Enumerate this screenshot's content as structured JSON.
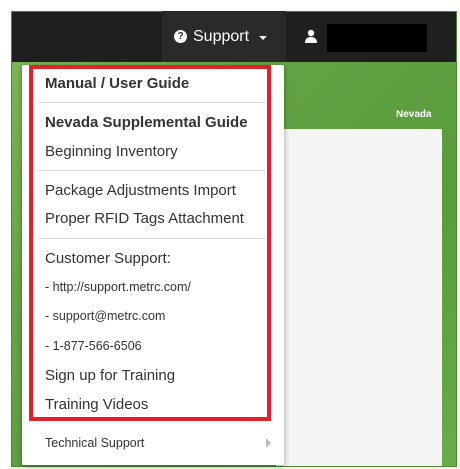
{
  "topbar": {
    "support_label": "Support",
    "help_icon": "question-circle-icon",
    "user_icon": "user-icon"
  },
  "background": {
    "state_label": "Nevada"
  },
  "menu": {
    "groups": [
      {
        "items": [
          {
            "label": "Manual / User Guide",
            "bold": true
          }
        ]
      },
      {
        "items": [
          {
            "label": "Nevada Supplemental Guide",
            "bold": true
          },
          {
            "label": "Beginning Inventory",
            "bold": false
          }
        ]
      },
      {
        "items": [
          {
            "label": "Package Adjustments Import",
            "bold": false
          },
          {
            "label": "Proper RFID Tags Attachment",
            "bold": false
          }
        ]
      },
      {
        "items": [
          {
            "label": "Customer Support:",
            "bold": false
          },
          {
            "label": "- http://support.metrc.com/",
            "small": true
          },
          {
            "label": "- support@metrc.com",
            "small": true
          },
          {
            "label": "- 1-877-566-6506",
            "small": true
          },
          {
            "label": "Sign up for Training",
            "bold": false
          },
          {
            "label": "Training Videos",
            "bold": false
          }
        ]
      }
    ],
    "technical_support_label": "Technical Support"
  },
  "colors": {
    "highlight": "#e0222a",
    "topbar": "#1f1f1f",
    "background_green": "#63a344"
  }
}
